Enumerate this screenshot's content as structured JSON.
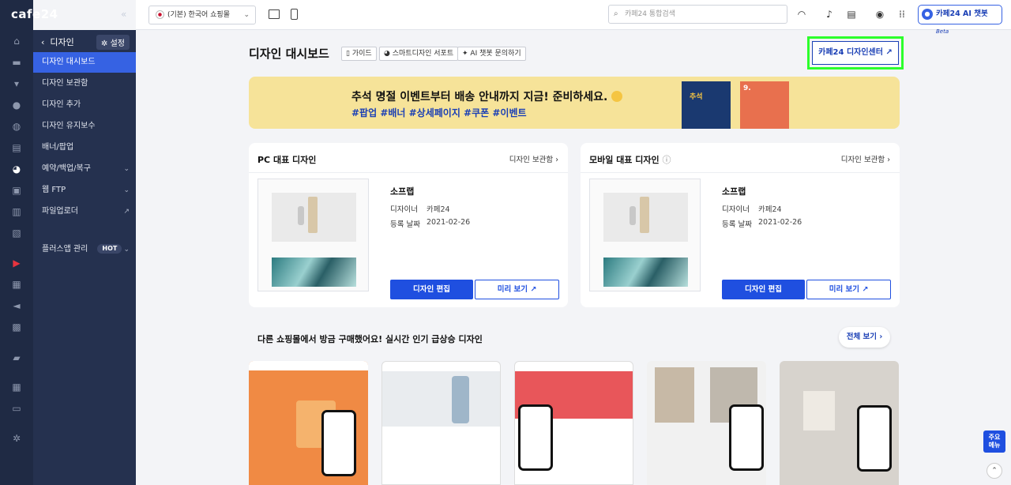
{
  "brand": {
    "logo": "cafe24",
    "collapse": "«"
  },
  "sidebar": {
    "back_label": "디자인",
    "setting_label": "설정",
    "items": [
      {
        "label": "디자인 대시보드"
      },
      {
        "label": "디자인 보관함"
      },
      {
        "label": "디자인 추가"
      },
      {
        "label": "디자인 유지보수"
      },
      {
        "label": "배너/팝업"
      },
      {
        "label": "예약/백업/복구"
      },
      {
        "label": "웹 FTP"
      },
      {
        "label": "파일업로더"
      },
      {
        "label": "플러스앱 관리",
        "badge": "HOT"
      }
    ]
  },
  "topbar": {
    "mall_select": "(기본) 한국어 쇼핑몰",
    "search_placeholder": "카페24 통합검색",
    "ai_label": "카페24 AI 챗봇",
    "ai_beta": "Beta"
  },
  "main": {
    "title": "디자인 대시보드",
    "chips": [
      "가이드",
      "스마트디자인 서포트",
      "AI 챗봇 문의하기"
    ],
    "design_center": "카페24 디자인센터"
  },
  "banner": {
    "line1": "추석 명절 이벤트부터 배송 안내까지 지금! 준비하세요.",
    "line2": "#팝업 #배너 #상세페이지 #쿠폰 #이벤트",
    "img1_text": "추석",
    "img2_text": "9."
  },
  "cards": [
    {
      "title": "PC 대표 디자인",
      "link": "디자인 보관함",
      "name": "소프랩",
      "designer_label": "디자이너",
      "designer": "카페24",
      "date_label": "등록 날짜",
      "date": "2021-02-26",
      "edit": "디자인 편집",
      "preview": "미리 보기"
    },
    {
      "title": "모바일 대표 디자인",
      "link": "디자인 보관함",
      "name": "소프랩",
      "designer_label": "디자이너",
      "designer": "카페24",
      "date_label": "등록 날짜",
      "date": "2021-02-26",
      "edit": "디자인 편집",
      "preview": "미리 보기"
    }
  ],
  "popular": {
    "title": "다른 쇼핑몰에서 방금 구매했어요! 실시간 인기 급상승 디자인",
    "all_label": "전체 보기"
  },
  "floating": {
    "quick_line1": "주요",
    "quick_line2": "메뉴"
  }
}
